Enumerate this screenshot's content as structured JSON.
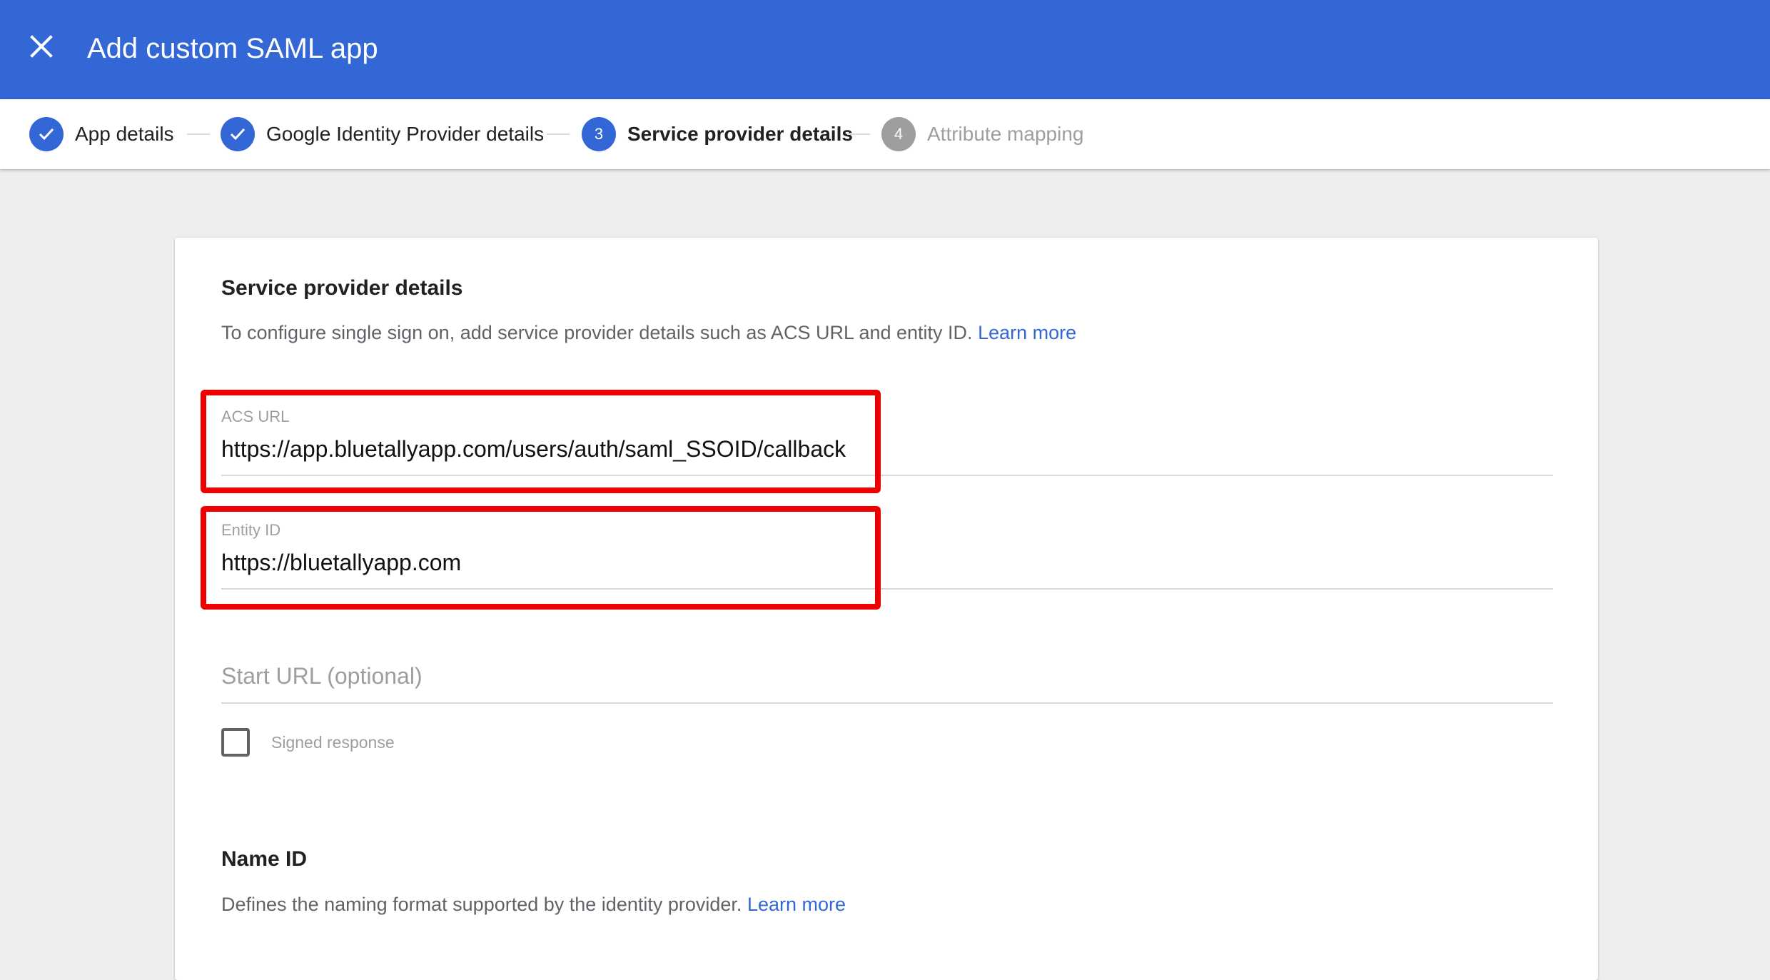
{
  "header": {
    "title": "Add custom SAML app",
    "close_icon": "close-icon"
  },
  "stepper": {
    "steps": [
      {
        "number": "1",
        "label": "App details",
        "state": "done"
      },
      {
        "number": "2",
        "label": "Google Identity Provider details",
        "state": "done"
      },
      {
        "number": "3",
        "label": "Service provider details",
        "state": "active"
      },
      {
        "number": "4",
        "label": "Attribute mapping",
        "state": "pending"
      }
    ]
  },
  "service_provider": {
    "title": "Service provider details",
    "description": "To configure single sign on, add service provider details such as ACS URL and entity ID.",
    "learn_more": "Learn more",
    "acs_url": {
      "label": "ACS URL",
      "value": "https://app.bluetallyapp.com/users/auth/saml_SSOID/callback"
    },
    "entity_id": {
      "label": "Entity ID",
      "value": "https://bluetallyapp.com"
    },
    "start_url": {
      "placeholder": "Start URL (optional)"
    },
    "signed_response": {
      "label": "Signed response",
      "checked": false
    }
  },
  "name_id": {
    "title": "Name ID",
    "description": "Defines the naming format supported by the identity provider.",
    "learn_more": "Learn more"
  },
  "colors": {
    "brand_blue": "#3367d6",
    "highlight_red": "#ee0000",
    "pending_grey": "#9e9e9e"
  }
}
